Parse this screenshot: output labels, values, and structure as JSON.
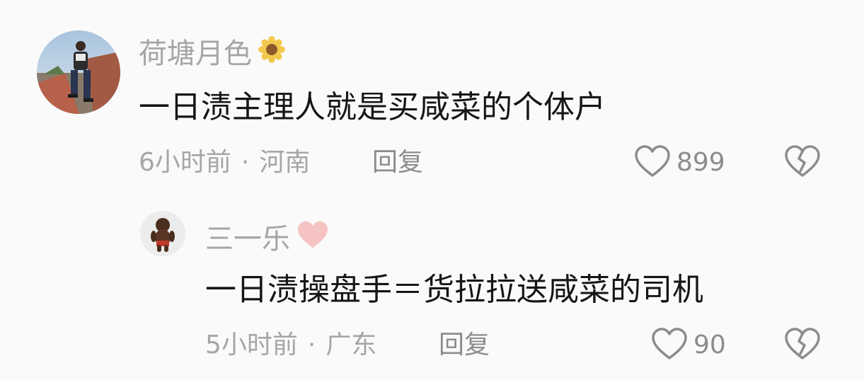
{
  "comments": [
    {
      "username": "荷塘月色",
      "badge_icon": "sunflower-icon",
      "text": "一日渍主理人就是买咸菜的个体户",
      "time": "6小时前",
      "separator": "·",
      "location": "河南",
      "reply_label": "回复",
      "like_count": "899"
    },
    {
      "username": "三一乐",
      "badge_icon": "pink-heart-icon",
      "text": "一日渍操盘手＝货拉拉送咸菜的司机",
      "time": "5小时前",
      "separator": "·",
      "location": "广东",
      "reply_label": "回复",
      "like_count": "90"
    }
  ],
  "colors": {
    "background": "#fafafa",
    "username": "#a6a6a6",
    "text": "#161616",
    "meta": "#a6a6a6",
    "icon": "#8c8c8c",
    "pink_heart": "#f6c3c3",
    "sunflower": "#f2c94c"
  }
}
